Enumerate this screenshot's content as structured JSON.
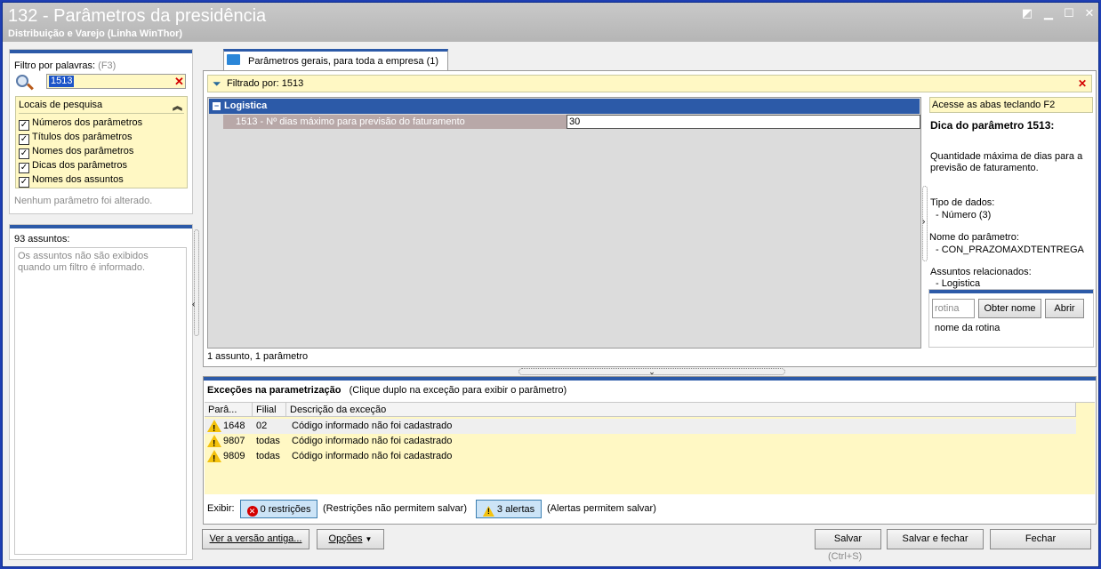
{
  "window": {
    "title": "132 - Parâmetros da presidência",
    "subtitle": "Distribuição e Varejo (Linha WinThor)",
    "controls": [
      "restore",
      "minimize",
      "maximize",
      "close"
    ]
  },
  "left": {
    "filter_label": "Filtro por palavras:",
    "filter_shortcut": "(F3)",
    "filter_value": "1513",
    "locais_title": "Locais de pesquisa",
    "locais": [
      "Números dos parâmetros",
      "Títulos dos parâmetros",
      "Nomes dos parâmetros",
      "Dicas dos parâmetros",
      "Nomes dos assuntos"
    ],
    "none_changed": "Nenhum parâmetro foi alterado.",
    "assuntos_title": "93 assuntos:",
    "assuntos_note": "Os assuntos não são exibidos quando um filtro é informado."
  },
  "tab": {
    "label": "Parâmetros gerais, para toda a empresa",
    "count": "(1)"
  },
  "main": {
    "filter_text": "Filtrado por: 1513",
    "group": "Logistica",
    "param_name": "1513 - Nº dias máximo para previsão do faturamento",
    "param_value": "30",
    "status": "1 assunto, 1 parâmetro"
  },
  "tip": {
    "hint": "Acesse as abas teclando F2",
    "title": "Dica do parâmetro 1513:",
    "description": "Quantidade máxima de dias para a previsão de faturamento.",
    "type_label": "Tipo de dados:",
    "type_value": "- Número (3)",
    "name_label": "Nome do parâmetro:",
    "name_value": "- CON_PRAZOMAXDTENTREGA",
    "subjects_label": "Assuntos relacionados:",
    "subjects_value": "- Logistica",
    "rotina_placeholder": "rotina",
    "get_name_button": "Obter nome",
    "open_button": "Abrir",
    "routine_name": "nome da rotina"
  },
  "exceptions": {
    "title": "Exceções na parametrização",
    "hint": "(Clique duplo na exceção para exibir o parâmetro)",
    "columns": [
      "Parâ...",
      "Filial",
      "Descrição da exceção"
    ],
    "rows": [
      {
        "param": "1648",
        "filial": "02",
        "desc": "Código informado não foi cadastrado"
      },
      {
        "param": "9807",
        "filial": "todas",
        "desc": "Código informado não foi cadastrado"
      },
      {
        "param": "9809",
        "filial": "todas",
        "desc": "Código informado não foi cadastrado"
      }
    ],
    "show_label": "Exibir:",
    "restrictions_button": "0 restrições",
    "restrictions_note": "(Restrições não permitem salvar)",
    "alerts_button": "3 alertas",
    "alerts_note": "(Alertas permitem salvar)"
  },
  "footer": {
    "old_version_button": "Ver a versão antiga...",
    "options_button": "Opções",
    "save_button": "Salvar",
    "save_shortcut": "(Ctrl+S)",
    "save_close_button": "Salvar e fechar",
    "close_button": "Fechar"
  },
  "colors": {
    "accent": "#2c5aa8",
    "highlight": "#fff8c4",
    "error": "#d40000",
    "warning": "#f4c20d"
  }
}
